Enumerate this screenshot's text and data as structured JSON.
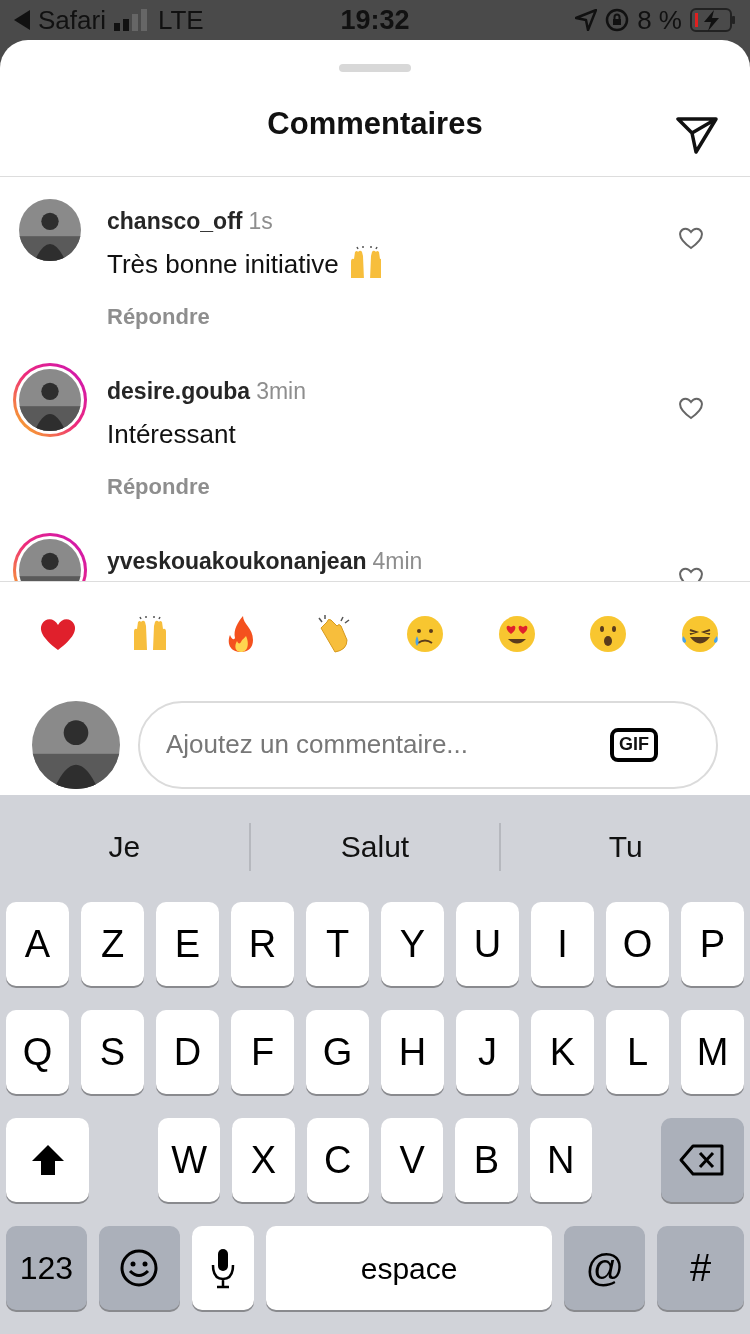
{
  "status_bar": {
    "back_label": "Safari",
    "network": "LTE",
    "time": "19:32",
    "battery": "8 %"
  },
  "sheet": {
    "title": "Commentaires"
  },
  "comments": [
    {
      "user": "chansco_off",
      "time": "1s",
      "text": "Très bonne initiative",
      "trailing_icon": {
        "kind": "hands"
      },
      "reply": "Répondre",
      "story_ring": false
    },
    {
      "user": "desire.gouba",
      "time": "3min",
      "text": "Intéressant",
      "reply": "Répondre",
      "story_ring": true
    },
    {
      "user": "yveskouakoukonanjean",
      "time": "4min",
      "story_ring": true
    }
  ],
  "reactions": [
    {
      "kind": "heart"
    },
    {
      "kind": "hands"
    },
    {
      "kind": "fire"
    },
    {
      "kind": "clap"
    },
    {
      "kind": "crying"
    },
    {
      "kind": "hearteyes"
    },
    {
      "kind": "surprised"
    },
    {
      "kind": "laughing"
    }
  ],
  "composer": {
    "placeholder": "Ajoutez un commentaire...",
    "gif_label": "GIF"
  },
  "keyboard": {
    "suggestions": [
      "Je",
      "Salut",
      "Tu"
    ],
    "rows": [
      {
        "keys": [
          {
            "kind": "letter",
            "label": "A"
          },
          {
            "kind": "letter",
            "label": "Z"
          },
          {
            "kind": "letter",
            "label": "E"
          },
          {
            "kind": "letter",
            "label": "R"
          },
          {
            "kind": "letter",
            "label": "T"
          },
          {
            "kind": "letter",
            "label": "Y"
          },
          {
            "kind": "letter",
            "label": "U"
          },
          {
            "kind": "letter",
            "label": "I"
          },
          {
            "kind": "letter",
            "label": "O"
          },
          {
            "kind": "letter",
            "label": "P"
          }
        ]
      },
      {
        "keys": [
          {
            "kind": "letter",
            "label": "Q"
          },
          {
            "kind": "letter",
            "label": "S"
          },
          {
            "kind": "letter",
            "label": "D"
          },
          {
            "kind": "letter",
            "label": "F"
          },
          {
            "kind": "letter",
            "label": "G"
          },
          {
            "kind": "letter",
            "label": "H"
          },
          {
            "kind": "letter",
            "label": "J"
          },
          {
            "kind": "letter",
            "label": "K"
          },
          {
            "kind": "letter",
            "label": "L"
          },
          {
            "kind": "letter",
            "label": "M"
          }
        ]
      },
      {
        "keys": [
          {
            "kind": "shift"
          },
          {
            "kind": "letter",
            "label": "W"
          },
          {
            "kind": "letter",
            "label": "X"
          },
          {
            "kind": "letter",
            "label": "C"
          },
          {
            "kind": "letter",
            "label": "V"
          },
          {
            "kind": "letter",
            "label": "B"
          },
          {
            "kind": "letter",
            "label": "N"
          },
          {
            "kind": "delete"
          }
        ]
      },
      {
        "keys": [
          {
            "kind": "numbers",
            "label": "123"
          },
          {
            "kind": "emoji"
          },
          {
            "kind": "mic"
          },
          {
            "kind": "space",
            "label": "espace"
          },
          {
            "kind": "at",
            "label": "@"
          },
          {
            "kind": "hash",
            "label": "#"
          }
        ]
      }
    ]
  }
}
